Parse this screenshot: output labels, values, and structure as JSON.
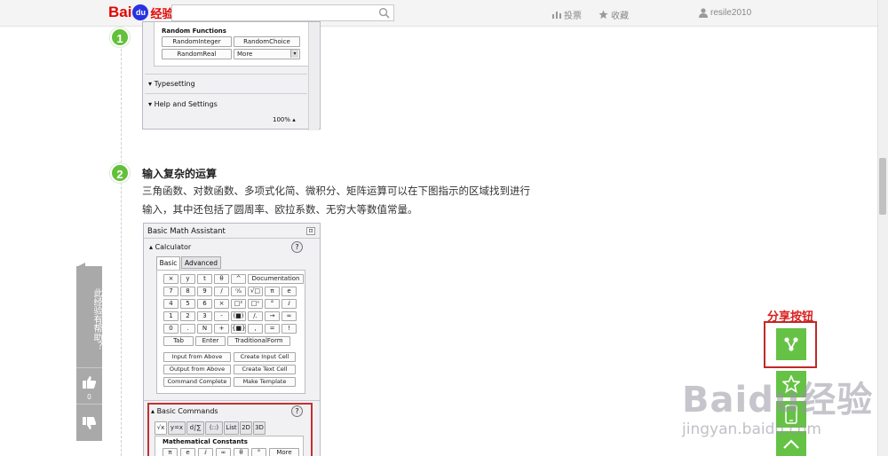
{
  "header": {
    "logo_text": "Bai",
    "logo_paw": "du",
    "logo_suffix": "经验",
    "search_placeholder": "",
    "vote_label": "投票",
    "favorite_label": "收藏",
    "username": "resile2010"
  },
  "step1": {
    "number": "1",
    "panel": {
      "section_random": "Random Functions",
      "buttons": [
        "RandomInteger",
        "RandomChoice",
        "RandomReal",
        "More"
      ],
      "typesetting": "Typesetting",
      "help": "Help and Settings",
      "zoom": "100%"
    }
  },
  "step2": {
    "number": "2",
    "title": "输入复杂的运算",
    "body": "三角函数、对数函数、多项式化简、微积分、矩阵运算可以在下图指示的区域找到进行输入，其中还包括了圆周率、欧拉系数、无穷大等数值常量。",
    "panel": {
      "window_title": "Basic Math Assistant",
      "calculator": "Calculator",
      "tabs": [
        "Basic",
        "Advanced"
      ],
      "grid": [
        [
          "×",
          "y",
          "t",
          "θ",
          "^",
          "Documentation"
        ],
        [
          "7",
          "8",
          "9",
          "/",
          "ⁿ⁄ₐ",
          "√□",
          "π",
          "e"
        ],
        [
          "4",
          "5",
          "6",
          "×",
          "□²",
          "□ⁿ",
          "°",
          "ⅈ"
        ],
        [
          "1",
          "2",
          "3",
          "-",
          "(■)",
          "/.",
          "→",
          "∞"
        ],
        [
          "0",
          ".",
          "N",
          "+",
          "{■}",
          ",",
          "=",
          "!"
        ],
        [
          "Tab",
          "Enter",
          "TraditionalForm"
        ]
      ],
      "cell_buttons": [
        "Input from Above",
        "Create Input Cell",
        "Output from Above",
        "Create Text Cell",
        "Command Complete",
        "Make Template"
      ],
      "basic_commands": "Basic Commands",
      "cmd_tabs": [
        "√x",
        "y=x",
        "d∫∑",
        "(::)",
        "List",
        "2D",
        "3D"
      ],
      "constants": "Mathematical Constants",
      "constant_buttons": [
        "π",
        "e",
        "ⅈ",
        "∞",
        "θ",
        "°",
        "More"
      ],
      "help_icon": "?"
    }
  },
  "feedback": {
    "prompt": "此经验有帮助？",
    "like_count": "0"
  },
  "share": {
    "annotation": "分享按钮"
  },
  "watermark": {
    "main": "Baidu经验",
    "url": "jingyan.baidu.com"
  },
  "colors": {
    "green": "#66c245",
    "red": "#d9201d",
    "step_green": "#63c03a"
  }
}
